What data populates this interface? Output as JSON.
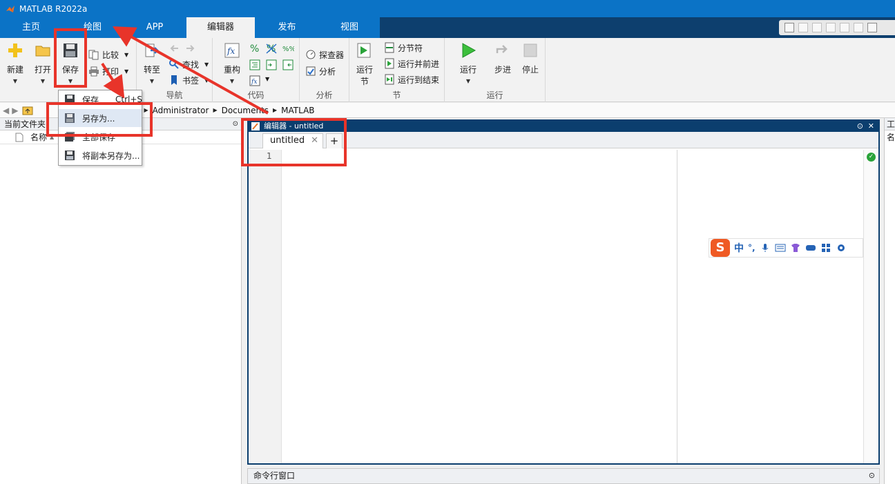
{
  "window": {
    "title": "MATLAB R2022a"
  },
  "tabs": [
    "主页",
    "绘图",
    "APP",
    "编辑器",
    "发布",
    "视图"
  ],
  "ribbon": {
    "file": {
      "new": "新建",
      "open": "打开",
      "save": "保存",
      "compare": "比较",
      "print": "打印"
    },
    "nav": {
      "goto": "转至",
      "find": "查找",
      "bookmark": "书签",
      "label": "导航"
    },
    "code": {
      "refactor": "重构",
      "label": "代码"
    },
    "analyze": {
      "profiler": "探查器",
      "analyze": "分析",
      "label": "分析"
    },
    "section": {
      "run_section": "运行\n节",
      "run_section_l1": "运行",
      "run_section_l2": "节",
      "section_break": "分节符",
      "run_advance": "运行并前进",
      "run_to_end": "运行到结束",
      "label": "节"
    },
    "run": {
      "run": "运行",
      "step": "步进",
      "stop": "停止",
      "label": "运行"
    }
  },
  "menu": {
    "items": [
      {
        "label": "保存",
        "shortcut": "Ctrl+S"
      },
      {
        "label": "另存为..."
      },
      {
        "label": "全部保存"
      },
      {
        "label": "将副本另存为..."
      }
    ]
  },
  "address": {
    "crumbs": [
      "Administrator",
      "Documents",
      "MATLAB"
    ]
  },
  "current_folder": {
    "title": "当前文件夹",
    "col_name": "名称"
  },
  "editor": {
    "title": "编辑器 - untitled",
    "tab": "untitled",
    "line_number": "1"
  },
  "command_window": {
    "title": "命令行窗口"
  },
  "workspace": {
    "title": "工",
    "col": "名"
  },
  "ime": {
    "label": "中"
  },
  "colors": {
    "accent": "#0b73c6",
    "annotation": "#e8342a",
    "run_green": "#2aa33a"
  }
}
